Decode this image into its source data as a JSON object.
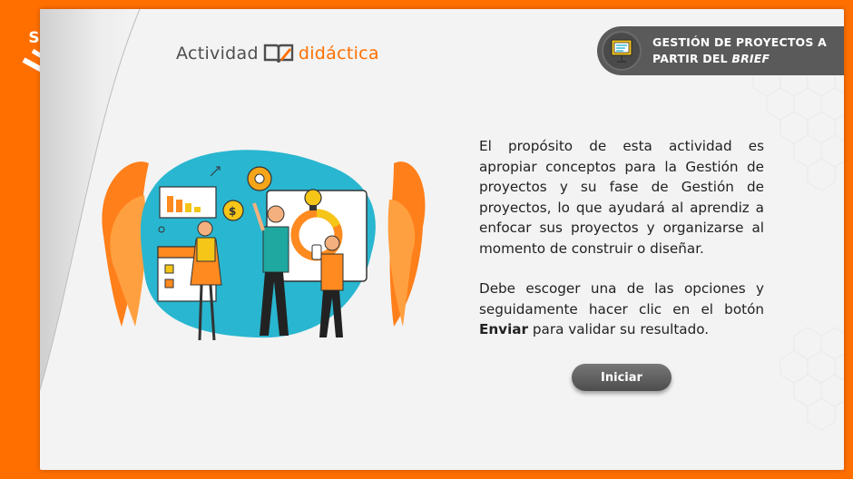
{
  "brand": {
    "logo_text": "SENA",
    "activity_prefix": "Actividad",
    "activity_suffix": "didáctica"
  },
  "topic": {
    "line1": "GESTIÓN DE PROYECTOS A",
    "line2_prefix": "PARTIR DEL ",
    "line2_emph": "BRIEF",
    "icon": "presentation-board-icon"
  },
  "description": {
    "paragraph1": "El propósito de esta actividad es apropiar conceptos para la Gestión de proyectos y su fase de Gestión de proyectos, lo que ayudará al aprendiz a enfocar sus proyectos y organizarse al momento de construir o diseñar.",
    "paragraph2_prefix": "Debe escoger una de las opciones y seguidamente hacer clic en el botón ",
    "paragraph2_bold": "Enviar",
    "paragraph2_suffix": " para validar su resultado."
  },
  "actions": {
    "start_label": "Iniciar"
  },
  "colors": {
    "accent": "#ff6f00",
    "panel": "#f3f3f3",
    "dark": "#5a5a5a",
    "teal": "#29b6d0"
  }
}
